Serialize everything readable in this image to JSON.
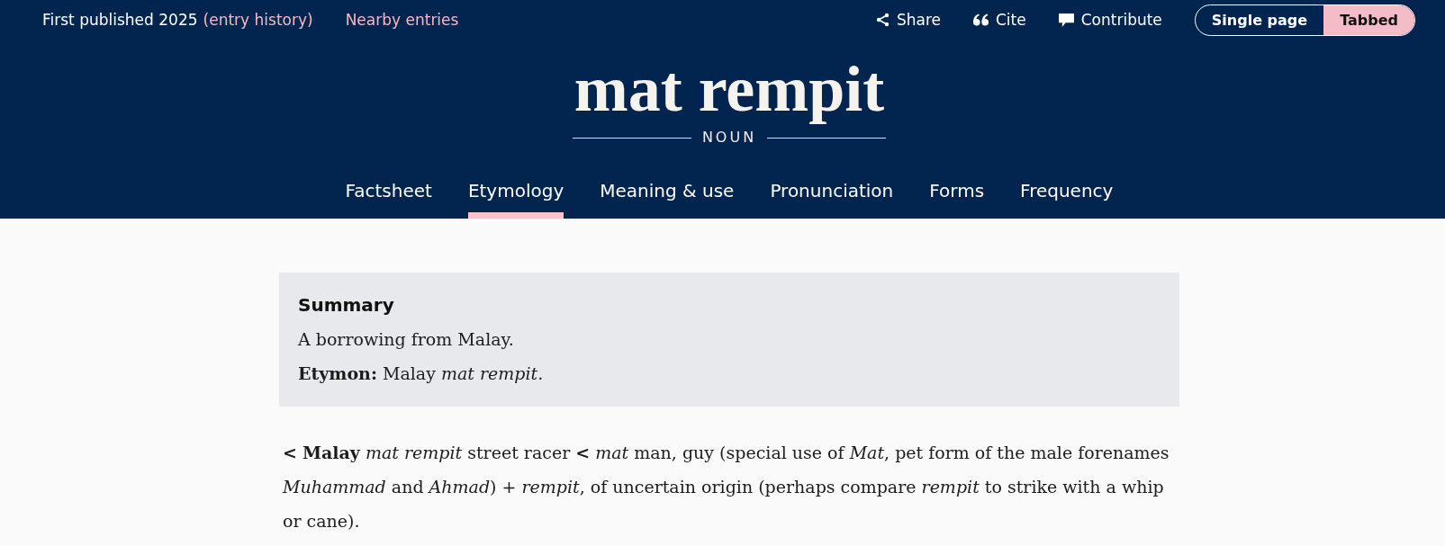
{
  "top_bar": {
    "published": "First published 2025",
    "history_link": "(entry history)",
    "nearby_link": "Nearby entries",
    "actions": [
      {
        "kind": "share",
        "label": "Share"
      },
      {
        "kind": "cite",
        "label": "Cite"
      },
      {
        "kind": "contribute",
        "label": "Contribute"
      }
    ],
    "view_toggle": [
      {
        "label": "Single page",
        "selected": false
      },
      {
        "label": "Tabbed",
        "selected": true
      }
    ]
  },
  "entry": {
    "headword": "mat rempit",
    "part_of_speech": "NOUN"
  },
  "tabs": [
    {
      "label": "Factsheet",
      "selected": false
    },
    {
      "label": "Etymology",
      "selected": true
    },
    {
      "label": "Meaning & use",
      "selected": false
    },
    {
      "label": "Pronunciation",
      "selected": false
    },
    {
      "label": "Forms",
      "selected": false
    },
    {
      "label": "Frequency",
      "selected": false
    }
  ],
  "summary": {
    "heading": "Summary",
    "lines": [
      "A borrowing from Malay.",
      "**Etymon:** Malay *mat rempit*."
    ]
  },
  "etymology_text": "**<** **Malay** *mat rempit* street racer **<** *mat* man, guy (special use of *Mat*, pet form of the male forenames *Muhammad* and *Ahmad*) + *rempit*, of uncertain origin (perhaps compare *rempit* to strike with a whip or cane)."
}
